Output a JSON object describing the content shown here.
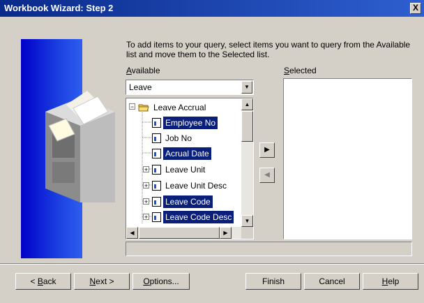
{
  "window": {
    "title": "Workbook Wizard: Step 2",
    "close_glyph": "X"
  },
  "instructions": "To add items to your query, select items you want to query from the Available list and move them to the Selected list.",
  "available": {
    "label_hotkey": "A",
    "label_rest": "vailable",
    "combo_value": "Leave",
    "tree": [
      {
        "label": "Leave Accrual",
        "type": "folder",
        "expander": "−",
        "selected": false
      },
      {
        "label": "Employee No",
        "type": "item",
        "selected": true
      },
      {
        "label": "Job No",
        "type": "item",
        "selected": false
      },
      {
        "label": "Acrual Date",
        "type": "item",
        "selected": true
      },
      {
        "label": "Leave Unit",
        "type": "item",
        "expander": "+",
        "selected": false
      },
      {
        "label": "Leave Unit Desc",
        "type": "item",
        "expander": "+",
        "selected": false
      },
      {
        "label": "Leave Code",
        "type": "item",
        "expander": "+",
        "selected": true
      },
      {
        "label": "Leave Code Desc",
        "type": "item",
        "expander": "+",
        "selected": true
      }
    ]
  },
  "selected": {
    "label_hotkey": "S",
    "label_rest": "elected"
  },
  "buttons": {
    "back_hotkey": "B",
    "back_prefix": "< ",
    "back_rest": "ack",
    "next_hotkey": "N",
    "next_rest": "ext >",
    "options_hotkey": "O",
    "options_rest": "ptions...",
    "finish": "Finish",
    "cancel": "Cancel",
    "help_hotkey": "H",
    "help_rest": "elp"
  },
  "colors": {
    "title_bar": "#0a2a8a",
    "selection": "#0a1f7a",
    "face": "#d4d0c8",
    "banner": "#1a3fe0"
  }
}
